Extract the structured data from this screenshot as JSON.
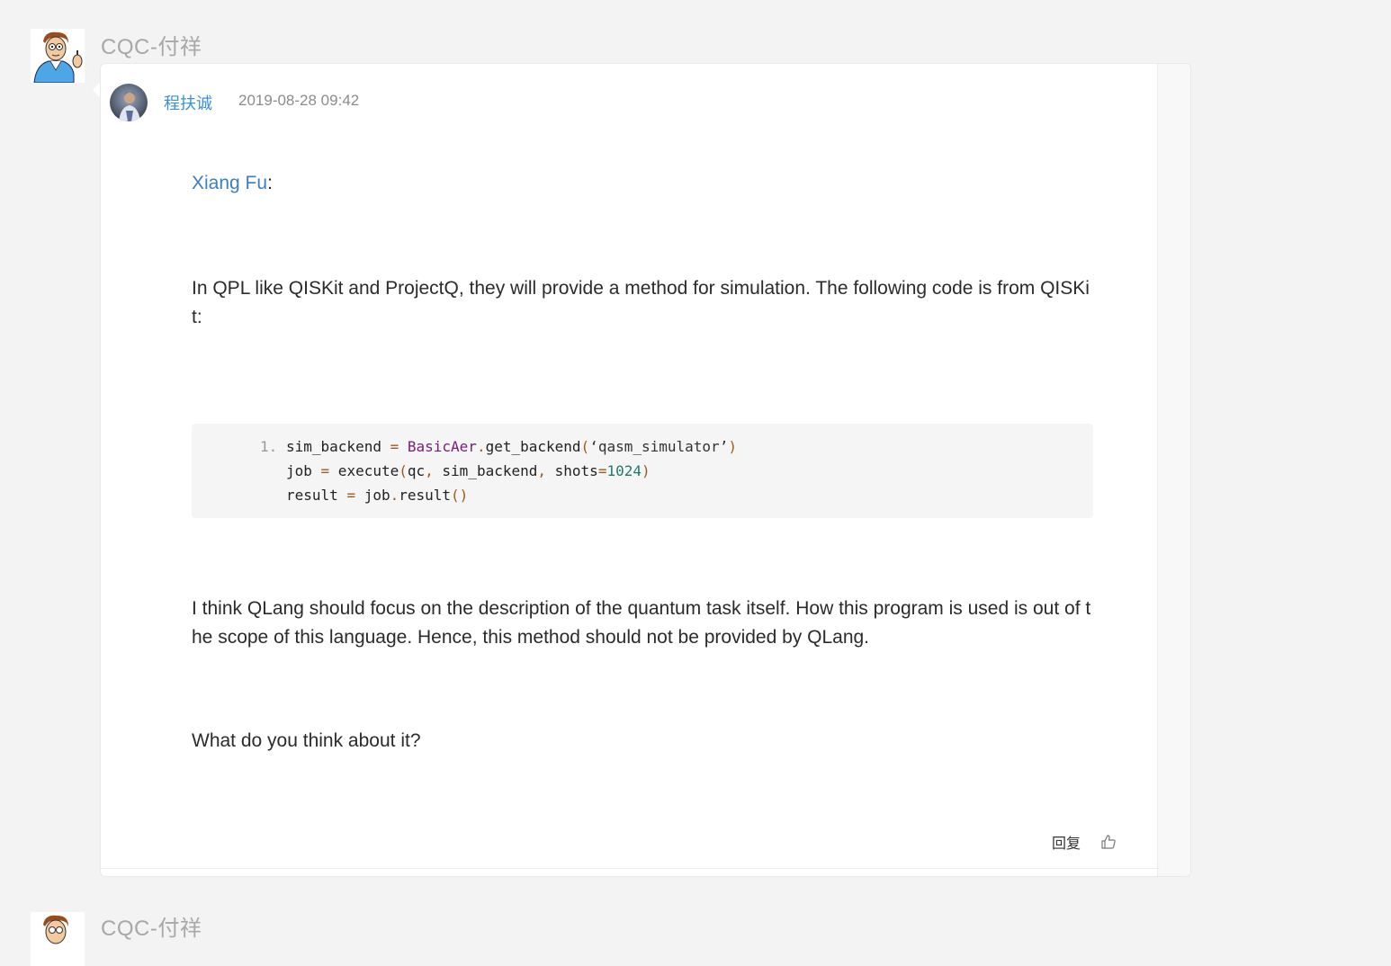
{
  "thread": {
    "name": "CQC-付祥",
    "next_name": "CQC-付祥"
  },
  "post": {
    "author": "程扶诚",
    "time": "2019-08-28 09:42",
    "mention_name": "Xiang Fu",
    "mention_suffix": ":",
    "paragraph1": "In QPL like QISKit and ProjectQ, they will provide a method for simulation. The following code is from QISKit:",
    "code": {
      "line_number": "1.",
      "lines": [
        "sim_backend = BasicAer.get_backend(‘qasm_simulator’)",
        "job = execute(qc, sim_backend, shots=1024)",
        "result = job.result()"
      ]
    },
    "paragraph2": "I think QLang should focus on the description of the quantum task itself. How this program is used is out of the scope of this language. Hence, this method should not be provided by QLang.",
    "paragraph3": "What do you think about it?",
    "actions": {
      "reply_label": "回复",
      "like_icon": "thumbs-up-icon"
    }
  },
  "colors": {
    "link": "#3b8fd9",
    "mention": "#3b7fc4",
    "code_bg": "#f5f5f5",
    "page_bg": "#f3f3f3"
  }
}
